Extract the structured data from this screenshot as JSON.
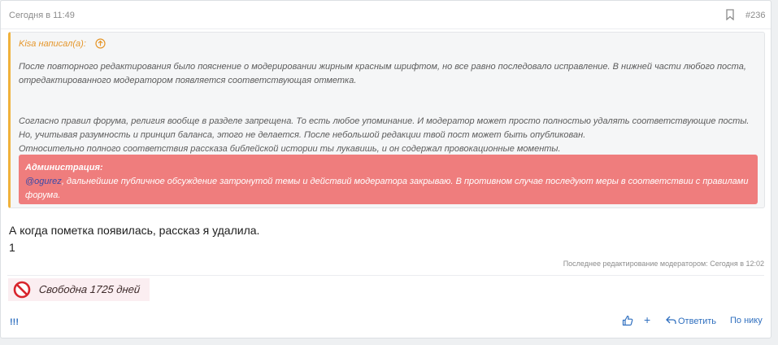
{
  "post": {
    "date": "Сегодня в 11:49",
    "number": "#236"
  },
  "quote": {
    "author": "Kisa написал(а):",
    "paragraph1": "После повторного редактирования было пояснение о модерировании жирным красным шрифтом, но все равно последовало исправление. В нижней части любого поста, отредактированного модератором появляется соответствующая отметка.",
    "paragraph2_line1": "Согласно правил форума, религия вообще в разделе запрещена. То есть любое упоминание. И модератор может просто полностью удалять соответствующие посты. Но, учитывая разумность и принцип баланса, этого не делается. После небольшой редакции твой пост может быть опубликован.",
    "paragraph2_line2": "Относительно полного соответствия рассказа библейской истории ты лукавишь, и он содержал провокационные моменты.",
    "admin_title": "Администрация:",
    "admin_user": "@ogurez",
    "admin_text": ", дальнейшие публичное обсуждение затронутой темы и действий модератора закрываю. В противном случае последуют меры в соответствии с правилами форума."
  },
  "body": {
    "line1": "А когда пометка появилась, рассказ я удалила.",
    "line2": "1"
  },
  "edit_note": "Последнее редактирование модератором: Сегодня в 12:02",
  "signature": {
    "text": "Свободна 1725 дней",
    "icon": "ban-icon"
  },
  "footer": {
    "left_icon": "!!!",
    "plus": "+",
    "reply_label": "Ответить",
    "down_label": "По нику"
  },
  "colors": {
    "accent": "#2f6fbf",
    "quote_border": "#f0b23c",
    "admin_bg": "#ef7d7d"
  }
}
